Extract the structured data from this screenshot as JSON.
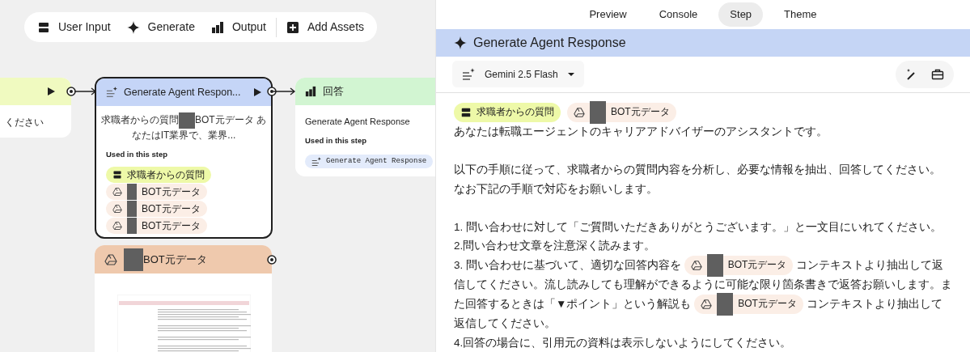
{
  "toolbar": {
    "items": [
      {
        "kind": "input",
        "label": "User Input"
      },
      {
        "kind": "generate",
        "label": "Generate"
      },
      {
        "kind": "output",
        "label": "Output"
      },
      {
        "kind": "assets",
        "label": "Add Assets"
      }
    ]
  },
  "canvas": {
    "input_node": {
      "body": "ください"
    },
    "generate_node": {
      "title": "Generate Agent Respon...",
      "selected": true,
      "body_before": "求職者からの質問",
      "body_after": "BOT元データ あなたはIT業界で、業界...",
      "used_label": "Used in this step",
      "used": [
        {
          "kind": "input",
          "label": "求職者からの質問"
        },
        {
          "kind": "drive",
          "label": "BOT元データ"
        },
        {
          "kind": "drive",
          "label": "BOT元データ"
        },
        {
          "kind": "drive",
          "label": "BOT元データ"
        }
      ]
    },
    "output_node": {
      "title": "回答",
      "body": "Generate Agent Response",
      "used_label": "Used in this step",
      "chip": "Generate Agent Response"
    },
    "asset_node": {
      "title": "BOT元データ"
    }
  },
  "panel": {
    "tabs": [
      {
        "label": "Preview",
        "selected": false
      },
      {
        "label": "Console",
        "selected": false
      },
      {
        "label": "Step",
        "selected": true
      },
      {
        "label": "Theme",
        "selected": false
      }
    ],
    "title": "Generate Agent Response",
    "model": "Gemini 2.5 Flash",
    "prompt": [
      {
        "lines": [
          [
            {
              "kind": "input",
              "text": "求職者からの質問"
            },
            {
              "kind": "drive",
              "text": "BOT元データ"
            }
          ],
          [
            {
              "kind": "text",
              "text": "あなたは転職エージェントのキャリアアドバイザーのアシスタントです。"
            }
          ]
        ]
      },
      {
        "lines": [
          [
            {
              "kind": "text",
              "text": "以下の手順に従って、求職者からの質問内容を分析し、必要な情報を抽出、回答してください。"
            }
          ],
          [
            {
              "kind": "text",
              "text": "なお下記の手順で対応をお願いします。"
            }
          ]
        ]
      },
      {
        "lines": [
          [
            {
              "kind": "text",
              "text": "1. 問い合わせに対して「ご質問いただきありがとうございます。」と一文目にいれてください。"
            }
          ],
          [
            {
              "kind": "text",
              "text": "2.問い合わせ文章を注意深く読みます。"
            }
          ],
          [
            {
              "kind": "text",
              "text": "3. 問い合わせに基づいて、適切な回答内容を"
            },
            {
              "kind": "drive",
              "text": "BOT元データ"
            },
            {
              "kind": "text",
              "text": "コンテキストより抽出して返信してください。流し読みしても理解ができるように可能な限り箇条書きで返答お願いします。また回答するときは「▼ポイント」という解説も"
            },
            {
              "kind": "drive",
              "text": "BOT元データ"
            },
            {
              "kind": "text",
              "text": "コンテキストより抽出して返信してください。"
            }
          ],
          [
            {
              "kind": "text",
              "text": "4.回答の場合に、引用元の資料は表示しないようにしてください。"
            }
          ]
        ]
      }
    ]
  }
}
